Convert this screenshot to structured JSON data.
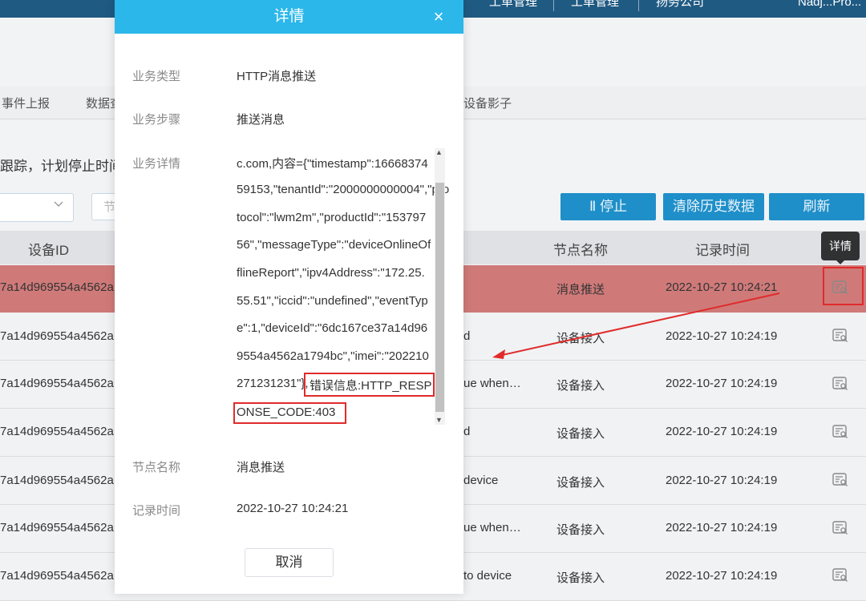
{
  "topbar": {
    "items": [
      "工单管理",
      "工单管理",
      "扬务公司",
      "Nadj...Pro..."
    ]
  },
  "nav": {
    "tabs": [
      "事件上报",
      "数据查",
      "设备影子"
    ]
  },
  "notice": "跟踪，计划停止时间",
  "filters": {
    "input_placeholder": "节"
  },
  "buttons": {
    "stop": "Ⅱ 停止",
    "clear_history": "清除历史数据",
    "refresh": "刷新"
  },
  "table": {
    "headers": {
      "device_id": "设备ID",
      "node_name": "节点名称",
      "record_time": "记录时间"
    },
    "rows": [
      {
        "device_id": "7a14d969554a4562a",
        "content": "",
        "node": "消息推送",
        "time": "2022-10-27 10:24:21"
      },
      {
        "device_id": "7a14d969554a4562a",
        "content": "d",
        "node": "设备接入",
        "time": "2022-10-27 10:24:19"
      },
      {
        "device_id": "7a14d969554a4562a",
        "content": "ue when…",
        "node": "设备接入",
        "time": "2022-10-27 10:24:19"
      },
      {
        "device_id": "7a14d969554a4562a",
        "content": "d",
        "node": "设备接入",
        "time": "2022-10-27 10:24:19"
      },
      {
        "device_id": "7a14d969554a4562a",
        "content": "device",
        "node": "设备接入",
        "time": "2022-10-27 10:24:19"
      },
      {
        "device_id": "7a14d969554a4562a",
        "content": "ue when…",
        "node": "设备接入",
        "time": "2022-10-27 10:24:19"
      },
      {
        "device_id": "7a14d969554a4562a",
        "content": "to device",
        "node": "设备接入",
        "time": "2022-10-27 10:24:19"
      }
    ],
    "tooltip": "详情",
    "detail_icon": "detail-document-icon"
  },
  "modal": {
    "title": "详情",
    "close_icon": "close-icon",
    "fields": {
      "biz_type_label": "业务类型",
      "biz_type_value": "HTTP消息推送",
      "biz_step_label": "业务步骤",
      "biz_step_value": "推送消息",
      "biz_detail_label": "业务详情",
      "node_label": "节点名称",
      "node_value": "消息推送",
      "time_label": "记录时间",
      "time_value": "2022-10-27 10:24:21"
    },
    "detail_lines": [
      "c.com,内容={\"timestamp\":16668374",
      "59153,\"tenantId\":\"2000000000004\",\"pro",
      "tocol\":\"lwm2m\",\"productId\":\"153797",
      "56\",\"messageType\":\"deviceOnlineOf",
      "flineReport\",\"ipv4Address\":\"172.25.",
      "55.51\",\"iccid\":\"undefined\",\"eventTyp",
      "e\":1,\"deviceId\":\"6dc167ce37a14d96",
      "9554a4562a1794bc\",\"imei\":\"202210",
      "271231231\"},"
    ],
    "error_part1": "错误信息:HTTP_RESP",
    "error_part2": "ONSE_CODE:403",
    "cancel": "取消"
  },
  "colors": {
    "header_blue": "#2bb7ea",
    "highlight_red": "#cf7a79",
    "annotation_red": "#e02b2b",
    "button_blue": "#1f8fc9"
  }
}
